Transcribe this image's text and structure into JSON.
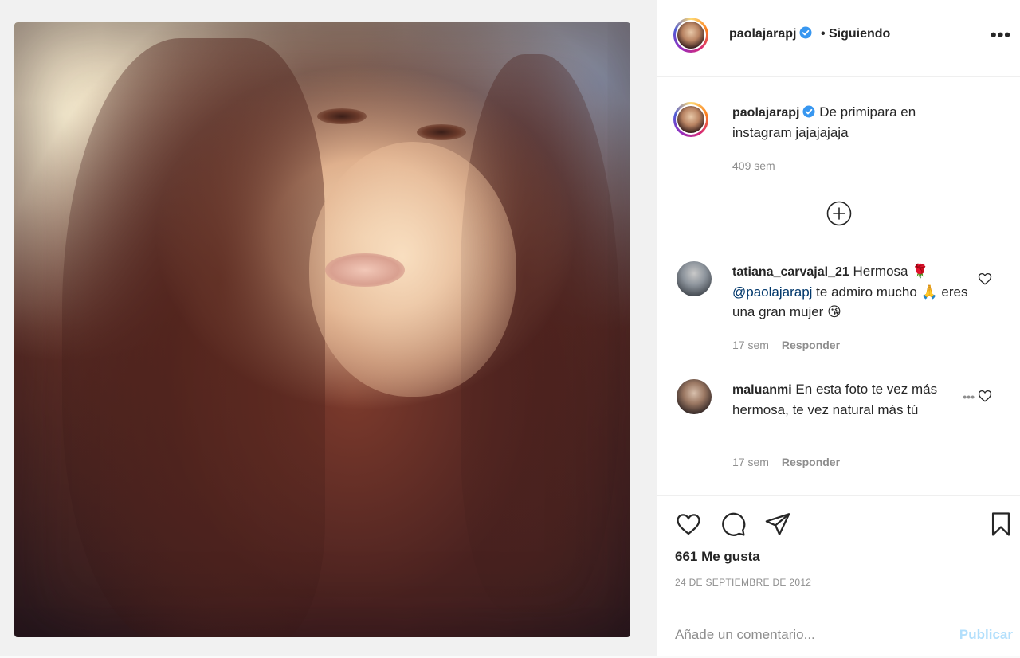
{
  "post": {
    "author": "paolajarapj",
    "follow_status": "• Siguiendo",
    "more_icon": "more-horizontal-icon"
  },
  "caption": {
    "author": "paolajarapj",
    "text": "De primipara en instagram jajajajaja",
    "time": "409 sem"
  },
  "load_more_icon": "plus-circle-icon",
  "comments": [
    {
      "author": "tatiana_carvajal_21",
      "text_before": "Hermosa 🌹",
      "mention": "@paolajarapj",
      "text_after": "te admiro mucho 🙏 eres una gran mujer 😘",
      "time": "17 sem",
      "reply_label": "Responder"
    },
    {
      "author": "maluanmi",
      "text": "En esta foto te vez más hermosa, te vez natural más tú",
      "time": "17 sem",
      "reply_label": "Responder"
    }
  ],
  "actions": {
    "icons": [
      "heart-icon",
      "comment-icon",
      "share-icon",
      "bookmark-icon"
    ],
    "likes": "661 Me gusta",
    "date": "24 DE SEPTIEMBRE DE 2012"
  },
  "add_comment": {
    "placeholder": "Añade un comentario...",
    "publish_label": "Publicar"
  },
  "colors": {
    "verified": "#3897f0",
    "publish_disabled": "#b2dffc",
    "meta_gray": "#8e8e8e",
    "mention": "#00376b"
  }
}
